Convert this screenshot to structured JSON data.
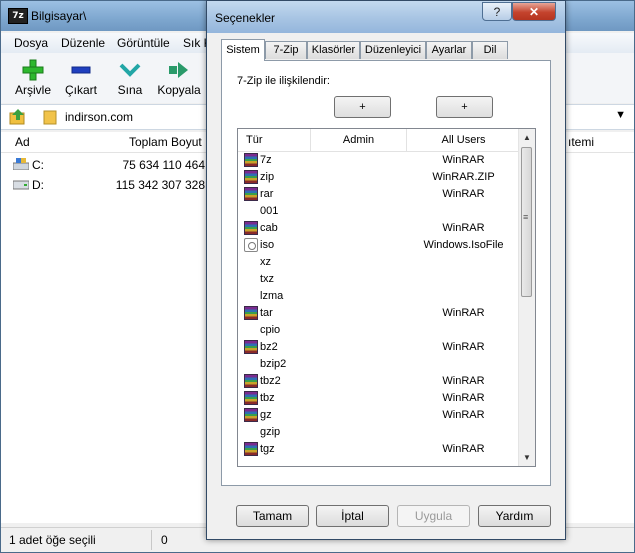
{
  "main_window": {
    "title": "Bilgisayar\\",
    "app_icon_text": "7z",
    "menu": [
      "Dosya",
      "Düzenle",
      "Görüntüle",
      "Sık K"
    ],
    "toolbar": [
      {
        "label": "Arşivle",
        "icon": "add-icon"
      },
      {
        "label": "Çıkart",
        "icon": "extract-icon"
      },
      {
        "label": "Sına",
        "icon": "test-icon"
      },
      {
        "label": "Kopyala",
        "icon": "copy-icon"
      }
    ],
    "address": "indirson.com",
    "columns": {
      "name": "Ad",
      "size": "Toplam Boyut",
      "right": "ıtemi"
    },
    "drives": [
      {
        "name": "C:",
        "size": "75 634 110 464"
      },
      {
        "name": "D:",
        "size": "115 342 307 328"
      }
    ],
    "status": {
      "selection": "1 adet öğe seçili",
      "count": "0"
    }
  },
  "dialog": {
    "title": "Seçenekler",
    "help_button": "?",
    "close_button": "✕",
    "tabs": [
      "Sistem",
      "7-Zip",
      "Klasörler",
      "Düzenleyici",
      "Ayarlar",
      "Dil"
    ],
    "active_tab": "Sistem",
    "assoc_label": "7-Zip ile ilişkilendir:",
    "plus_admin": "+",
    "plus_all": "+",
    "list_headers": {
      "type": "Tür",
      "admin": "Admin",
      "all_users": "All Users"
    },
    "rows": [
      {
        "ext": "7z",
        "icon": "rar",
        "all": "WinRAR"
      },
      {
        "ext": "zip",
        "icon": "rar",
        "all": "WinRAR.ZIP"
      },
      {
        "ext": "rar",
        "icon": "rar",
        "all": "WinRAR"
      },
      {
        "ext": "001",
        "icon": "none",
        "all": ""
      },
      {
        "ext": "cab",
        "icon": "rar",
        "all": "WinRAR"
      },
      {
        "ext": "iso",
        "icon": "iso",
        "all": "Windows.IsoFile"
      },
      {
        "ext": "xz",
        "icon": "none",
        "all": ""
      },
      {
        "ext": "txz",
        "icon": "none",
        "all": ""
      },
      {
        "ext": "lzma",
        "icon": "none",
        "all": ""
      },
      {
        "ext": "tar",
        "icon": "rar",
        "all": "WinRAR"
      },
      {
        "ext": "cpio",
        "icon": "none",
        "all": ""
      },
      {
        "ext": "bz2",
        "icon": "rar",
        "all": "WinRAR"
      },
      {
        "ext": "bzip2",
        "icon": "none",
        "all": ""
      },
      {
        "ext": "tbz2",
        "icon": "rar",
        "all": "WinRAR"
      },
      {
        "ext": "tbz",
        "icon": "rar",
        "all": "WinRAR"
      },
      {
        "ext": "gz",
        "icon": "rar",
        "all": "WinRAR"
      },
      {
        "ext": "gzip",
        "icon": "none",
        "all": ""
      },
      {
        "ext": "tgz",
        "icon": "rar",
        "all": "WinRAR"
      }
    ],
    "buttons": {
      "ok": "Tamam",
      "cancel": "İptal",
      "apply": "Uygula",
      "help": "Yardım"
    }
  }
}
